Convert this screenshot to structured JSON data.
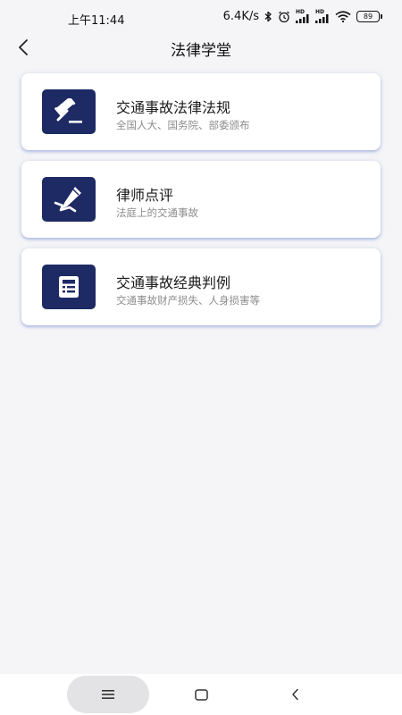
{
  "status_bar": {
    "time": "上午11:44",
    "network_speed": "6.4K/s",
    "signal_1_label": "HD",
    "signal_2_label": "HD",
    "battery": "89"
  },
  "header": {
    "title": "法律学堂"
  },
  "cards": [
    {
      "title": "交通事故法律法规",
      "subtitle": "全国人大、国务院、部委颁布",
      "icon": "gavel-icon"
    },
    {
      "title": "律师点评",
      "subtitle": "法庭上的交通事故",
      "icon": "pen-signature-icon"
    },
    {
      "title": "交通事故经典判例",
      "subtitle": "交通事故财产损失、人身损害等",
      "icon": "casebook-icon"
    }
  ],
  "theme": {
    "icon_bg": "#1d2a63",
    "page_bg": "#f5f5f7",
    "card_shadow": "#7891d2"
  },
  "bottom_nav": {
    "menu_icon": "menu-icon",
    "home_icon": "home-square-icon",
    "back_icon": "back-chevron-icon"
  }
}
